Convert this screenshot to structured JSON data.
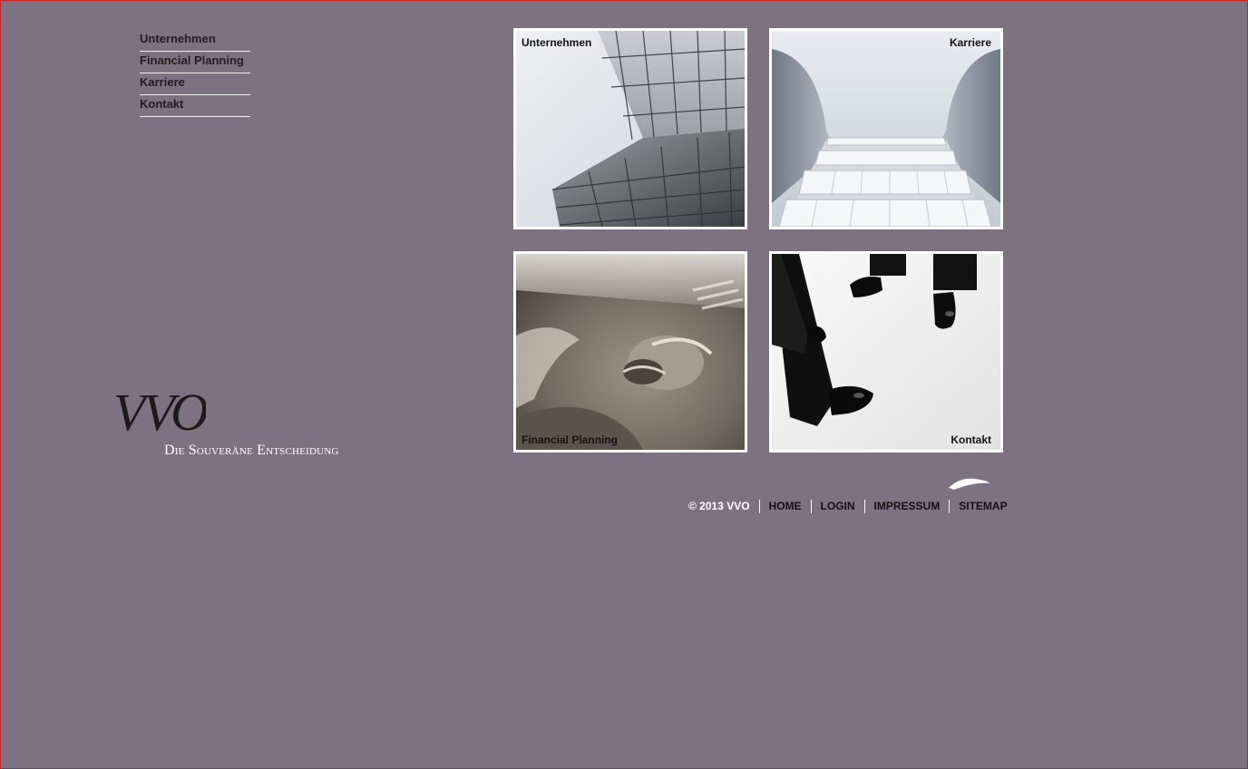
{
  "nav": {
    "items": [
      {
        "label": "Unternehmen"
      },
      {
        "label": "Financial Planning"
      },
      {
        "label": "Karriere"
      },
      {
        "label": "Kontakt"
      }
    ]
  },
  "logo": {
    "mark": "VVO",
    "tagline": "Die Souveräne Entscheidung"
  },
  "tiles": {
    "unternehmen": {
      "label": "Unternehmen",
      "image": "glass-skyscraper-icon"
    },
    "karriere": {
      "label": "Karriere",
      "image": "escalator-icon"
    },
    "financial": {
      "label": "Financial Planning",
      "image": "coin-closeup-icon"
    },
    "kontakt": {
      "label": "Kontakt",
      "image": "business-shoes-icon"
    }
  },
  "footer": {
    "copyright": "© 2013 VVO",
    "links": [
      {
        "label": "HOME"
      },
      {
        "label": "LOGIN"
      },
      {
        "label": "IMPRESSUM"
      },
      {
        "label": "SITEMAP"
      }
    ]
  },
  "colors": {
    "background": "#7e7282",
    "border_accent": "#d21e1e",
    "text_dark": "#231d22",
    "white": "#ffffff"
  }
}
